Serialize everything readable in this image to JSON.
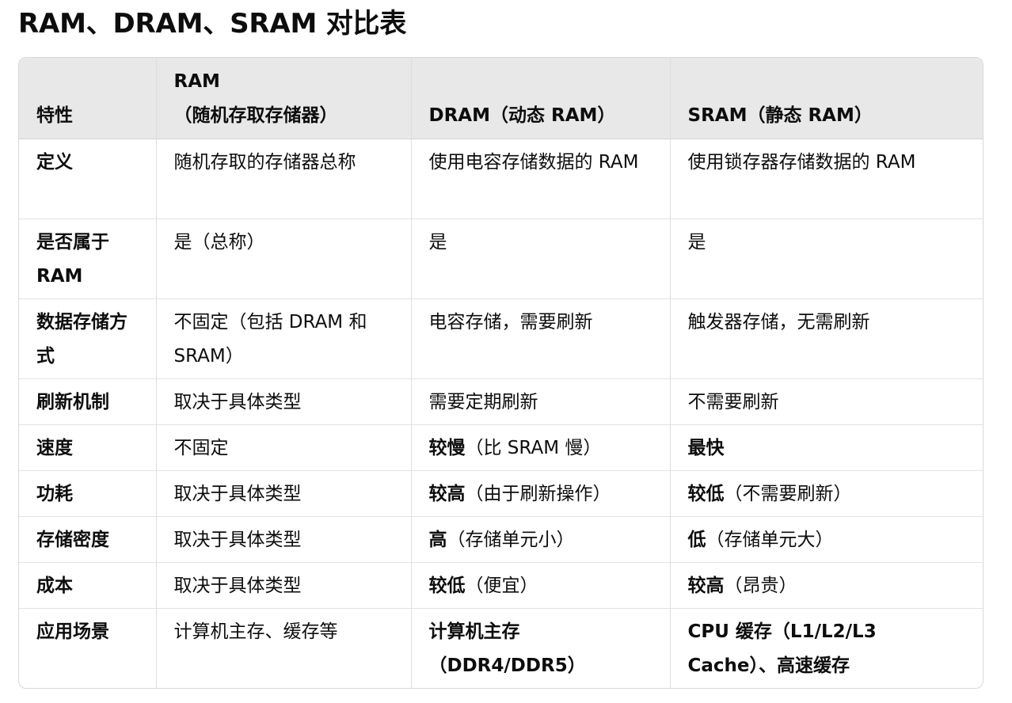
{
  "title": "RAM、DRAM、SRAM 对比表",
  "headers": {
    "feature": "特性",
    "ram_line1": "RAM",
    "ram_line2": "（随机存取存储器）",
    "dram": "DRAM（动态 RAM）",
    "sram": "SRAM（静态 RAM）"
  },
  "rows": [
    {
      "feature": "定义",
      "ram": "随机存取的存储器总称",
      "dram_bold": "",
      "dram": "使用电容存储数据的 RAM",
      "sram_bold": "",
      "sram": "使用锁存器存储数据的 RAM"
    },
    {
      "feature": "是否属于 RAM",
      "ram": "是（总称）",
      "dram_bold": "",
      "dram": "是",
      "sram_bold": "",
      "sram": "是"
    },
    {
      "feature": "数据存储方式",
      "ram": "不固定（包括 DRAM 和 SRAM）",
      "dram_bold": "",
      "dram": "电容存储，需要刷新",
      "sram_bold": "",
      "sram": "触发器存储，无需刷新"
    },
    {
      "feature": "刷新机制",
      "ram": "取决于具体类型",
      "dram_bold": "",
      "dram": "需要定期刷新",
      "sram_bold": "",
      "sram": "不需要刷新"
    },
    {
      "feature": "速度",
      "ram": "不固定",
      "dram_bold": "较慢",
      "dram": "（比 SRAM 慢）",
      "sram_bold": "最快",
      "sram": ""
    },
    {
      "feature": "功耗",
      "ram": "取决于具体类型",
      "dram_bold": "较高",
      "dram": "（由于刷新操作）",
      "sram_bold": "较低",
      "sram": "（不需要刷新）"
    },
    {
      "feature": "存储密度",
      "ram": "取决于具体类型",
      "dram_bold": "高",
      "dram": "（存储单元小）",
      "sram_bold": "低",
      "sram": "（存储单元大）"
    },
    {
      "feature": "成本",
      "ram": "取决于具体类型",
      "dram_bold": "较低",
      "dram": "（便宜）",
      "sram_bold": "较高",
      "sram": "（昂贵）"
    },
    {
      "feature": "应用场景",
      "ram": "计算机主存、缓存等",
      "dram_bold": "计算机主存（DDR4/DDR5）",
      "dram": "",
      "sram_bold": "CPU 缓存（L1/L2/L3 Cache）、高速缓存",
      "sram": ""
    }
  ]
}
